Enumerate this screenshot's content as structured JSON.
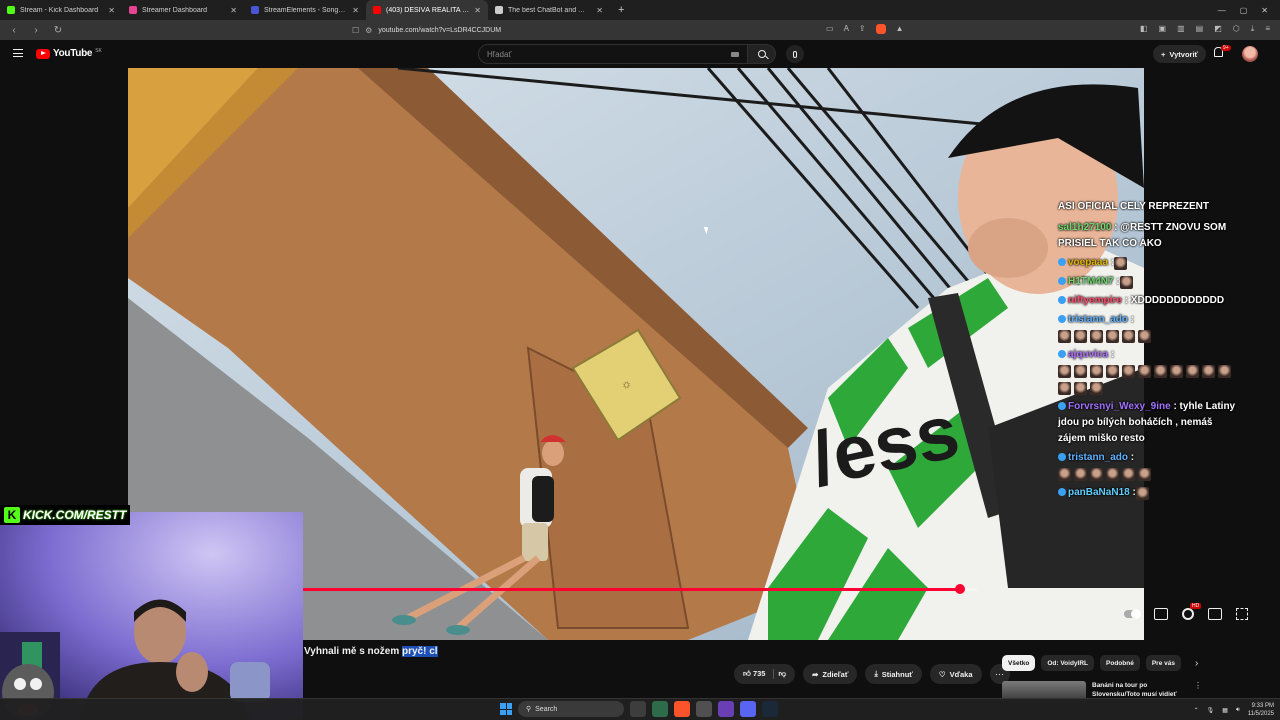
{
  "browser": {
    "tabs": [
      {
        "title": "Stream - Kick Dashboard",
        "color": "#53fc18"
      },
      {
        "title": "Streamer Dashboard",
        "color": "#e84393"
      },
      {
        "title": "StreamElements - Songrequest",
        "color": "#4a55d6"
      },
      {
        "title": "(403) DĚSIVÁ REALITA CHILE",
        "color": "#ff0000"
      },
      {
        "title": "The best ChatBot and Widgets for K",
        "color": "#cccccc"
      }
    ],
    "url": "youtube.com/watch?v=LsDR4CCJDUM"
  },
  "youtube": {
    "logo_text": "YouTube",
    "region": "SK",
    "search_placeholder": "Hľadať",
    "create_label": "Vytvoriť",
    "notifications_badge": "9+"
  },
  "overlay": {
    "kick_text": "KICK.COM/RESTT",
    "chat_header": "ASI OFICIAL CELY REPREZENT",
    "chat": [
      {
        "user": "sal1h27100",
        "text": ": @RESTT ZNOVU SOM PRISIEL TAK CO AKO",
        "color": "#6fd96f",
        "emotes": 0
      },
      {
        "user": "voepaaa",
        "text": ":",
        "color": "#e0b300",
        "emotes": 1
      },
      {
        "user": "H1TM4N7",
        "text": ":",
        "color": "#6fd96f",
        "emotes": 1
      },
      {
        "user": "niftyempire",
        "text": ": XDDDDDDDDDDDD",
        "color": "#ff4a6a",
        "emotes": 0
      },
      {
        "user": "tristann_ado",
        "text": ":",
        "color": "#5fb0ff",
        "emotes": 6
      },
      {
        "user": "ajquvica",
        "text": ":",
        "color": "#b06fff",
        "emotes": 14
      },
      {
        "user": "Forvrsnyi_Wexy_9ine",
        "text": ": tyhle Latiny jdou po bílých boháčích , nemáš zájem miško resto",
        "color": "#a070ff",
        "emotes": 0
      },
      {
        "user": "tristann_ado",
        "text": ":",
        "color": "#5fb0ff",
        "emotes": 6
      },
      {
        "user": "panBaNaN18",
        "text": ":",
        "color": "#5fcfff",
        "emotes": 1
      }
    ]
  },
  "player": {
    "progress_fraction": 0.975
  },
  "video": {
    "title_main": "Vyhnali mě s nožem ",
    "title_highlight": "pryč! cl",
    "likes": "735",
    "share_label": "Zdieľať",
    "download_label": "Stiahnuť",
    "thanks_label": "Vďaka",
    "more_label": "⋯"
  },
  "sidebar": {
    "chips": [
      "Všetko",
      "Od: VoidyIRL",
      "Podobné",
      "Pre vás"
    ],
    "rec_title": "Banáni na tour po Slovensku/Toto musí vidieť"
  },
  "taskbar": {
    "search_label": "Search",
    "time": "9:33 PM",
    "date": "11/5/2025"
  },
  "colors": {
    "progress": "#ff0033",
    "kick_green": "#53fc18",
    "yt_red": "#ff0000"
  }
}
